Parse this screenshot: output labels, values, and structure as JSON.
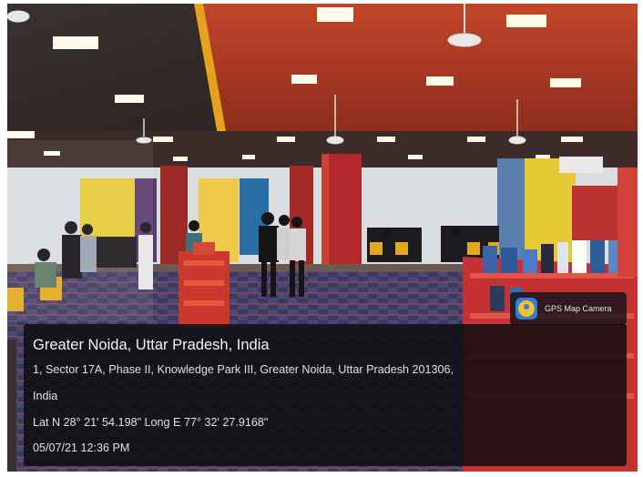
{
  "badge": {
    "label": "GPS Map Camera",
    "icon": "map-pin-icon"
  },
  "location": {
    "title": "Greater Noida, Uttar Pradesh, India",
    "address_line1": "1, Sector 17A, Phase II, Knowledge Park III, Greater Noida, Uttar Pradesh 201306,",
    "address_line2": "India",
    "coordinates": "Lat N 28° 21' 54.198\" Long E 77° 32' 27.9168\"",
    "datetime": "05/07/21 12:36 PM"
  },
  "colors": {
    "ceiling_red": "#b83a22",
    "pillar_red": "#b3282b",
    "shelf_red": "#c43234",
    "yellow_wall": "#e7c938",
    "floor_pattern": "#3b3a5e",
    "panel_bg": "#0c0c0e"
  }
}
